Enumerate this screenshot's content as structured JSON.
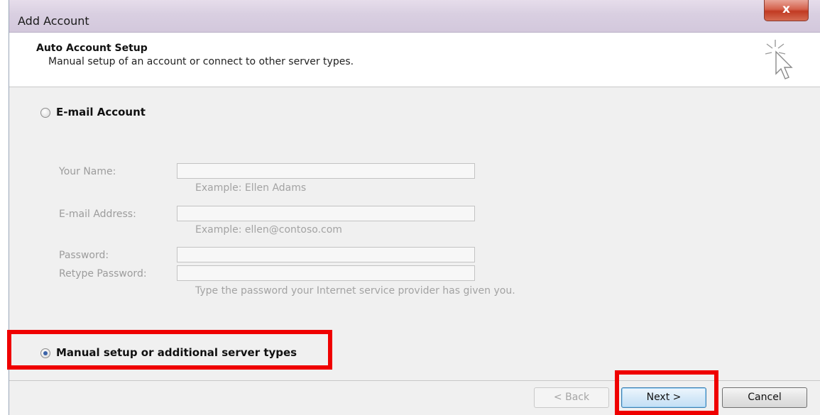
{
  "window": {
    "title": "Add Account",
    "close_glyph": "x"
  },
  "header": {
    "title": "Auto Account Setup",
    "subtitle": "Manual setup of an account or connect to other server types.",
    "icon": "cursor-sparkle-icon"
  },
  "options": {
    "email_account": {
      "label": "E-mail Account",
      "selected": false
    },
    "manual_setup": {
      "label": "Manual setup or additional server types",
      "selected": true
    }
  },
  "form": {
    "your_name": {
      "label": "Your Name:",
      "value": "",
      "hint": "Example: Ellen Adams"
    },
    "email_address": {
      "label": "E-mail Address:",
      "value": "",
      "hint": "Example: ellen@contoso.com"
    },
    "password": {
      "label": "Password:",
      "value": ""
    },
    "retype_password": {
      "label": "Retype Password:",
      "value": "",
      "hint": "Type the password your Internet service provider has given you."
    }
  },
  "buttons": {
    "back": "< Back",
    "next": "Next >",
    "cancel": "Cancel"
  },
  "colors": {
    "highlight": "#ef0000",
    "title_bar": "#d9cfe1",
    "dialog_bg": "#f0f0f0"
  }
}
